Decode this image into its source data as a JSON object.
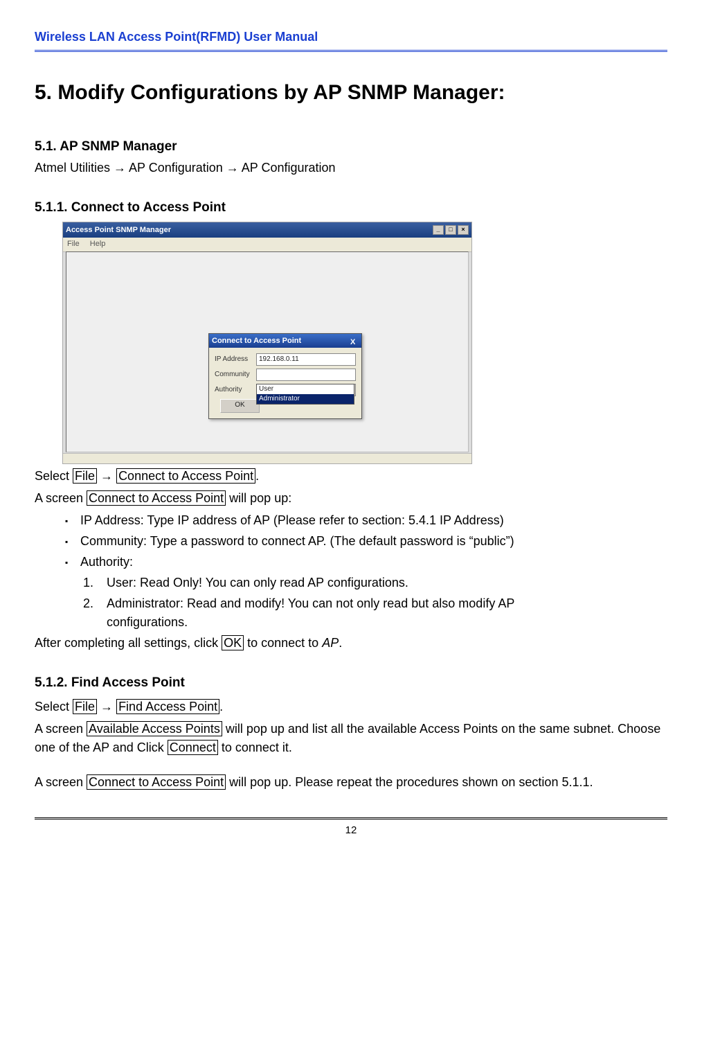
{
  "header": {
    "title": "Wireless LAN Access Point(RFMD) User Manual"
  },
  "chapter": {
    "number": "5.",
    "title": "Modify Configurations by AP SNMP Manager:"
  },
  "s51": {
    "heading_no": "5.1.",
    "heading": "AP SNMP Manager",
    "path": "Atmel Utilities → AP Configuration → AP Configuration"
  },
  "s511": {
    "heading_no": "5.1.1.",
    "heading": "Connect to Access Point",
    "select_pre": "Select ",
    "file": "File",
    "arrow": " → ",
    "menu_item": "Connect to Access Point",
    "select_post": ".",
    "screen_pre": "A screen ",
    "screen_name": "Connect to Access Point",
    "screen_post": " will pop up:",
    "bullets": {
      "ip": "IP Address: Type IP address of AP (Please refer to section: 5.4.1 IP Address)",
      "community": "Community: Type a password to connect AP. (The default password is “public”)",
      "authority": "Authority:"
    },
    "numbers": {
      "n1": "User: Read Only! You can only read AP configurations.",
      "n2a": "Administrator: Read and modify! You can not only read but also modify AP",
      "n2b": "configurations."
    },
    "after_pre": "After completing all settings, click ",
    "ok": "OK",
    "after_mid": " to connect to ",
    "ap": "AP",
    "after_post": "."
  },
  "s512": {
    "heading_no": "5.1.2.",
    "heading": "Find Access Point",
    "select_pre": "Select ",
    "file": "File",
    "arrow": " → ",
    "menu_item": "Find Access Point",
    "select_post": ".",
    "l2_pre": "A screen ",
    "l2_box": "Available Access Points",
    "l2_mid": " will pop up and list all the available Access Points on the same subnet. Choose one of the AP and Click ",
    "l2_box2": "Connect",
    "l2_post": " to connect it.",
    "l3_pre": "A screen ",
    "l3_box": "Connect to Access Point",
    "l3_post": " will pop up. Please repeat the procedures shown on section 5.1.1."
  },
  "footer": {
    "page": "12"
  },
  "screenshot": {
    "window_title": "Access Point SNMP Manager",
    "menu": {
      "file": "File",
      "help": "Help"
    },
    "dialog": {
      "title": "Connect to Access Point",
      "labels": {
        "ip": "IP Address",
        "community": "Community",
        "authority": "Authority"
      },
      "ip_value": "192.168.0.11",
      "authority_value": "User",
      "options": {
        "user": "User",
        "admin": "Administrator"
      },
      "ok": "OK",
      "close": "X"
    }
  }
}
